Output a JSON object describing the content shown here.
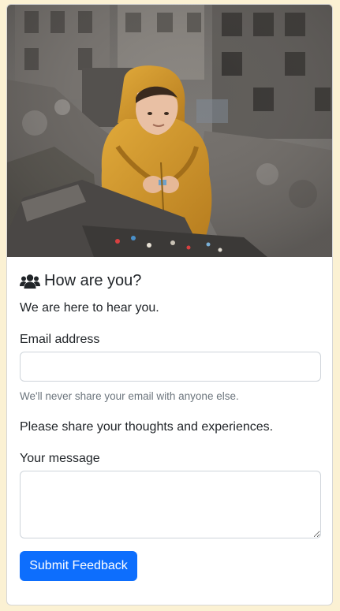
{
  "card": {
    "title": "How are you?",
    "title_icon": "users-icon",
    "subtitle": "We are here to hear you."
  },
  "form": {
    "email_label": "Email address",
    "email_value": "",
    "email_help": "We'll never share your email with anyone else.",
    "prompt": "Please share your thoughts and experiences.",
    "message_label": "Your message",
    "message_value": "",
    "submit_label": "Submit Feedback"
  },
  "colors": {
    "page_background": "#fbf1d3",
    "primary": "#0d6efd",
    "muted_text": "#6c757d",
    "input_border": "#ced4da"
  }
}
